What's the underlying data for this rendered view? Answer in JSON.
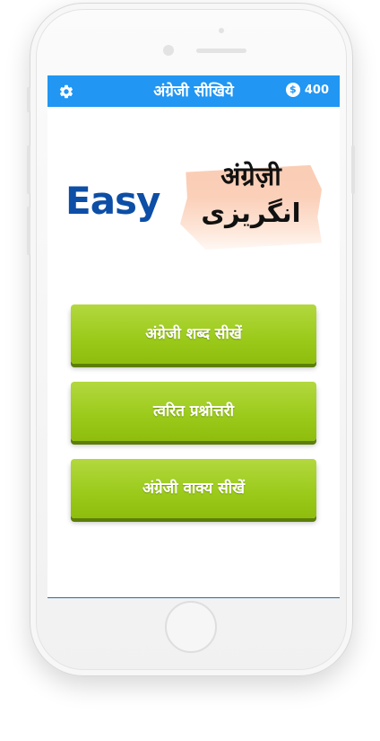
{
  "header": {
    "title": "अंग्रेजी सीखिये",
    "settings_icon": "gear-icon",
    "coin_icon_glyph": "$",
    "coin_count": "400",
    "bg_color": "#2196f3"
  },
  "logo": {
    "easy_text": "Easy",
    "hindi_text": "अंग्रेज़ी",
    "urdu_text": "انگریزی"
  },
  "menu": {
    "buttons": [
      {
        "label": "अंग्रेजी शब्द सीखें"
      },
      {
        "label": "त्वरित प्रश्नोत्तरी"
      },
      {
        "label": "अंग्रेजी वाक्य सीखें"
      }
    ],
    "button_color": "#9ccb1c"
  }
}
